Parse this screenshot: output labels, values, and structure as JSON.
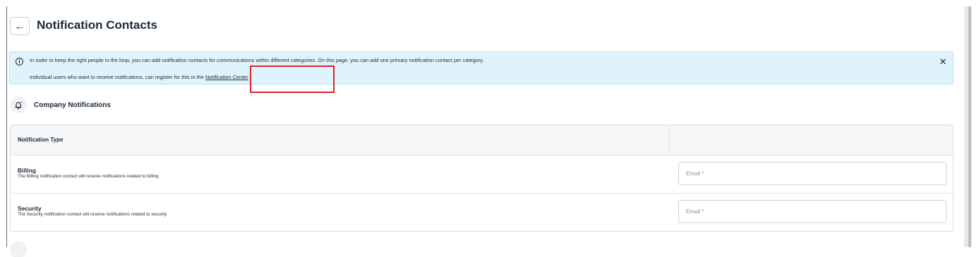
{
  "header": {
    "back_icon": "arrow-left-icon",
    "title": "Notification Contacts"
  },
  "banner": {
    "icon": "info-icon",
    "line1": "In order to keep the right people in the loop, you can add notification contacts for communications within different categories. On this page, you can add one primary notification contact per category.",
    "line2_prefix": "Individual users who want to receive notifications, can register for this in the ",
    "link_label": "Notification Center",
    "close_icon": "close-icon",
    "background": "#dff3fc"
  },
  "section": {
    "icon": "bell-icon",
    "title": "Company Notifications"
  },
  "table": {
    "header": "Notification Type",
    "rows": [
      {
        "title": "Billing",
        "description": "The Billing notification contact will receive notifications related to billing",
        "email_placeholder": "Email *",
        "email_value": ""
      },
      {
        "title": "Security",
        "description": "The Security notification contact will receive notifications related to security",
        "email_placeholder": "Email *",
        "email_value": ""
      }
    ]
  },
  "colors": {
    "highlight": "#e0212a",
    "title_text": "#1c2a3a"
  }
}
